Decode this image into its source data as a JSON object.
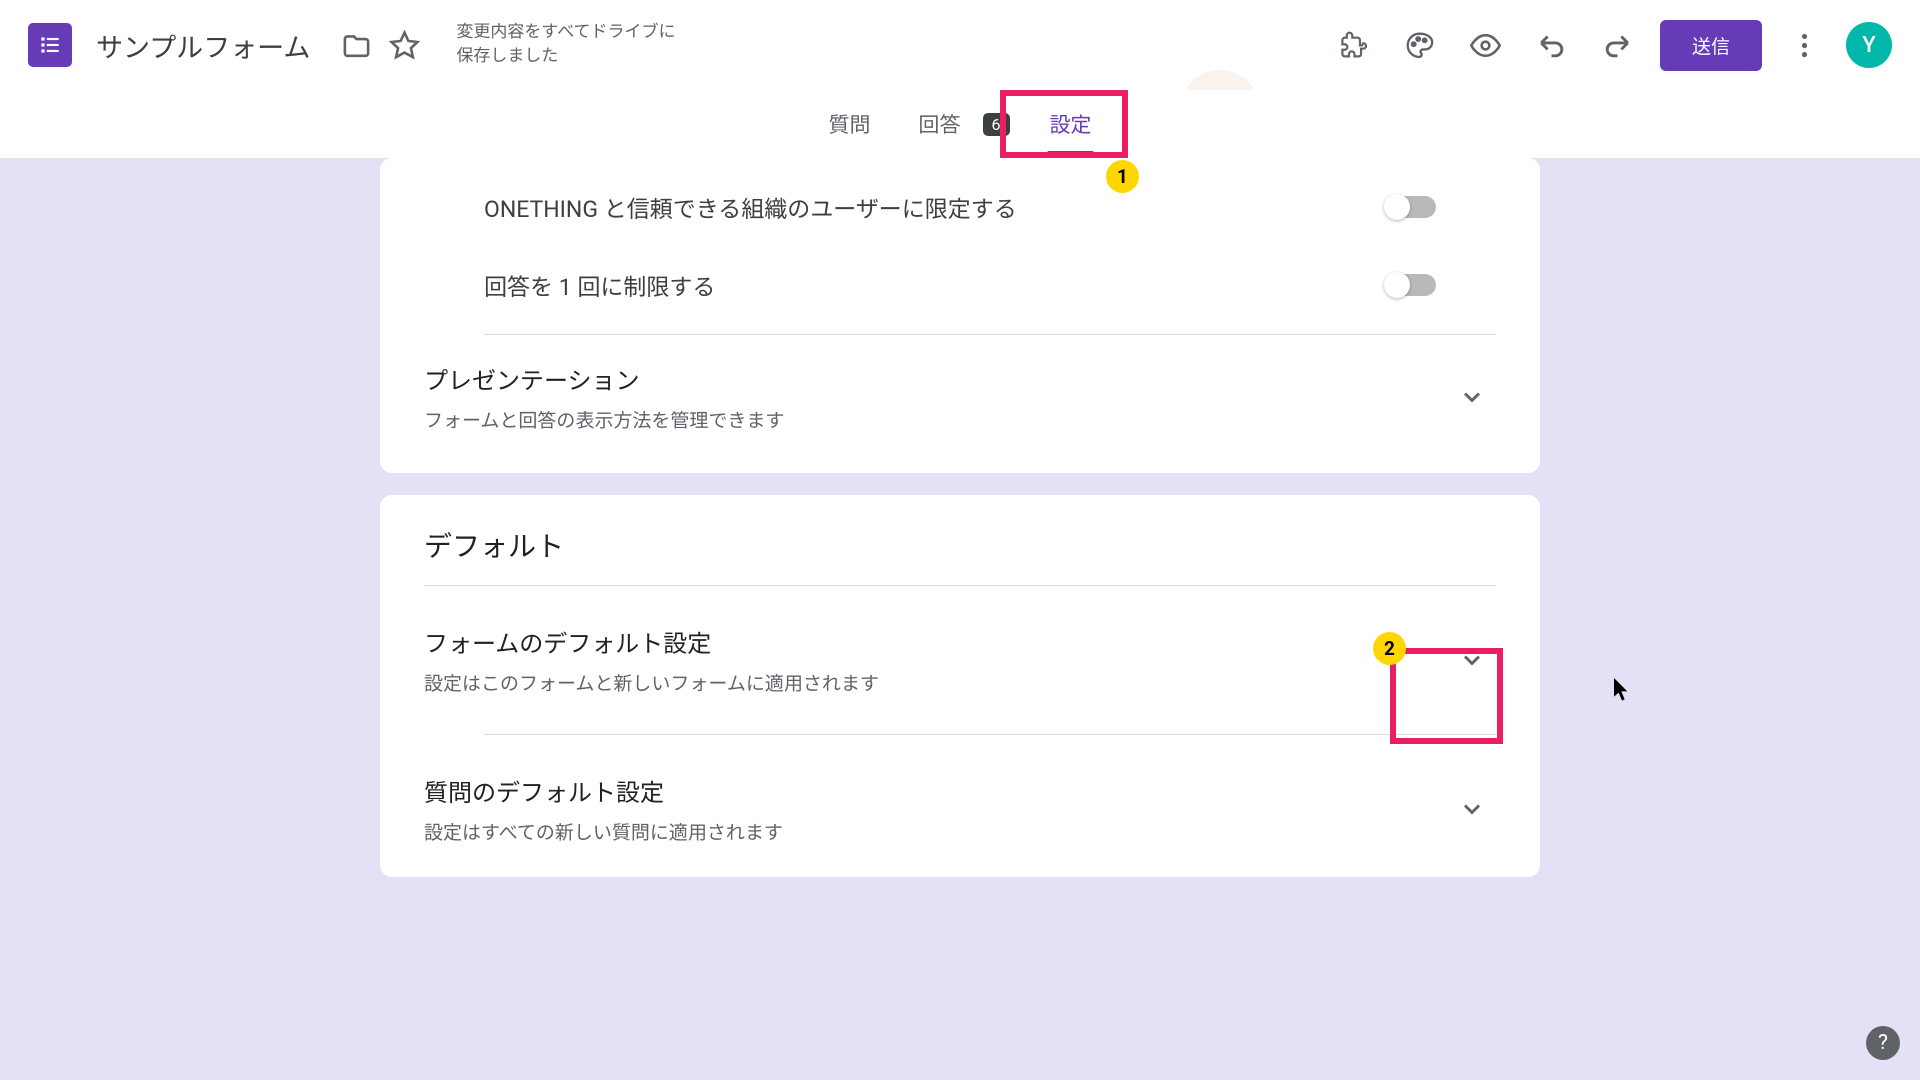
{
  "header": {
    "title": "サンプルフォーム",
    "save_status_line1": "変更内容をすべてドライブに",
    "save_status_line2": "保存しました",
    "submit_label": "送信",
    "avatar_letter": "Y"
  },
  "tabs": {
    "questions": "質問",
    "responses": "回答",
    "responses_count": "6",
    "settings": "設定"
  },
  "settings": {
    "limit_org_users": "ONETHING と信頼できる組織のユーザーに限定する",
    "limit_one_response": "回答を 1 回に制限する",
    "presentation_title": "プレゼンテーション",
    "presentation_desc": "フォームと回答の表示方法を管理できます"
  },
  "defaults": {
    "section_title": "デフォルト",
    "form_defaults_title": "フォームのデフォルト設定",
    "form_defaults_desc": "設定はこのフォームと新しいフォームに適用されます",
    "question_defaults_title": "質問のデフォルト設定",
    "question_defaults_desc": "設定はすべての新しい質問に適用されます"
  },
  "markers": {
    "m1": "1",
    "m2": "2"
  },
  "help_icon": "?"
}
